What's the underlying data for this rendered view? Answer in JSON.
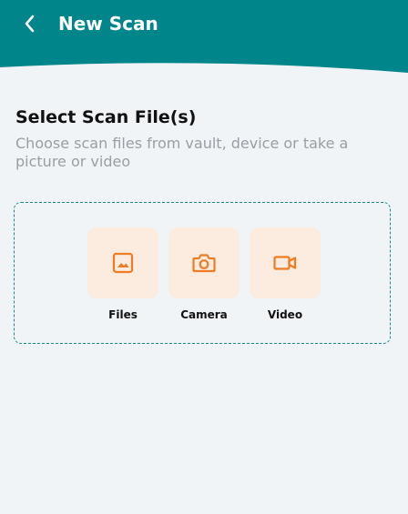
{
  "header": {
    "title": "New Scan",
    "back_icon": "chevron-left-icon",
    "background_color": "#00868a"
  },
  "section": {
    "title": "Select Scan File(s)",
    "subtitle": "Choose scan files from vault, device or take a picture or video"
  },
  "options": [
    {
      "label": "Files",
      "icon": "image-icon"
    },
    {
      "label": "Camera",
      "icon": "camera-icon"
    },
    {
      "label": "Video",
      "icon": "video-icon"
    }
  ],
  "colors": {
    "accent": "#f07b22",
    "tile_background": "#fcebdf",
    "dashed_border": "#1a8a8a",
    "page_background": "#f0f4f7"
  }
}
